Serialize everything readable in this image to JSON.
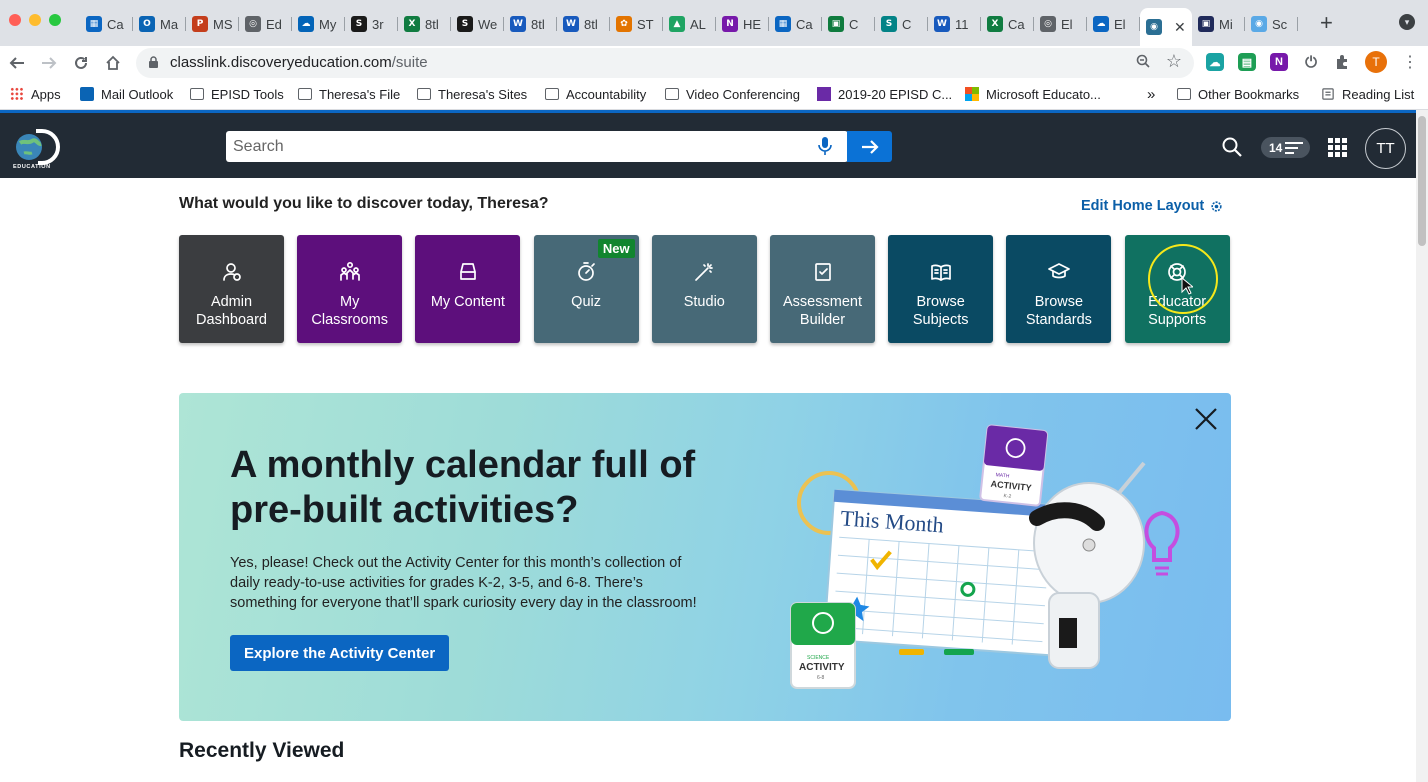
{
  "browser": {
    "tabs": [
      {
        "icon": "calendar-favicon",
        "label": "Ca",
        "color": "#0b66c2",
        "glyph": "▦"
      },
      {
        "icon": "outlook-favicon",
        "label": "Ma",
        "color": "#0a64b4",
        "glyph": "O"
      },
      {
        "icon": "powerpoint-favicon",
        "label": "MS",
        "color": "#c43e1c",
        "glyph": "P"
      },
      {
        "icon": "globe-favicon",
        "label": "Ed",
        "color": "#5f6368",
        "glyph": "◎"
      },
      {
        "icon": "onedrive-favicon",
        "label": "My",
        "color": "#0364b8",
        "glyph": "☁"
      },
      {
        "icon": "s-favicon",
        "label": "3r",
        "color": "#1a1a1a",
        "glyph": "S"
      },
      {
        "icon": "excel-favicon",
        "label": "8tl",
        "color": "#107c41",
        "glyph": "X"
      },
      {
        "icon": "s-favicon",
        "label": "We",
        "color": "#1a1a1a",
        "glyph": "S"
      },
      {
        "icon": "word-favicon",
        "label": "8tl",
        "color": "#185abd",
        "glyph": "W"
      },
      {
        "icon": "word-favicon",
        "label": "8tl",
        "color": "#185abd",
        "glyph": "W"
      },
      {
        "icon": "multicolor-favicon",
        "label": "ST",
        "color": "#e37400",
        "glyph": "✿"
      },
      {
        "icon": "drive-favicon",
        "label": "AL",
        "color": "#1fa463",
        "glyph": "▲"
      },
      {
        "icon": "onenote-favicon",
        "label": "HE",
        "color": "#7719aa",
        "glyph": "N"
      },
      {
        "icon": "calendar-favicon",
        "label": "Ca",
        "color": "#0b66c2",
        "glyph": "▦"
      },
      {
        "icon": "green-favicon",
        "label": "C",
        "color": "#0f7b3e",
        "glyph": "▣"
      },
      {
        "icon": "sharepoint-favicon",
        "label": "C",
        "color": "#038387",
        "glyph": "S"
      },
      {
        "icon": "word-favicon",
        "label": "11",
        "color": "#185abd",
        "glyph": "W"
      },
      {
        "icon": "excel-favicon",
        "label": "Ca",
        "color": "#107c41",
        "glyph": "X"
      },
      {
        "icon": "globe-favicon",
        "label": "El",
        "color": "#5f6368",
        "glyph": "◎"
      },
      {
        "icon": "cloud-favicon",
        "label": "El",
        "color": "#0b66c2",
        "glyph": "☁"
      },
      {
        "icon": "discovery-favicon",
        "label": "",
        "color": "#2b6f94",
        "glyph": "◉",
        "active": true
      },
      {
        "icon": "dark-favicon",
        "label": "Mi",
        "color": "#202a5a",
        "glyph": "▣"
      },
      {
        "icon": "circle-favicon",
        "label": "Sc",
        "color": "#5aa9e6",
        "glyph": "◉"
      }
    ],
    "url_host": "classlink.discoveryeducation.com",
    "url_path": "/suite",
    "bookmarks": [
      {
        "label": "Apps",
        "type": "apps"
      },
      {
        "label": "Mail Outlook",
        "type": "outlook"
      },
      {
        "label": "EPISD Tools",
        "type": "folder"
      },
      {
        "label": "Theresa's File",
        "type": "folder"
      },
      {
        "label": "Theresa's Sites",
        "type": "folder"
      },
      {
        "label": "Accountability",
        "type": "folder"
      },
      {
        "label": "Video Conferencing",
        "type": "folder"
      },
      {
        "label": "2019-20 EPISD C...",
        "type": "page"
      },
      {
        "label": "Microsoft Educato...",
        "type": "ms"
      }
    ],
    "bookmarks_overflow": "»",
    "other_bookmarks": "Other Bookmarks",
    "reading_list": "Reading List",
    "profile_initial": "T"
  },
  "header": {
    "search_placeholder": "Search",
    "notification_count": "14",
    "user_initials": "TT"
  },
  "greeting": "What would you like to discover today, Theresa?",
  "edit_layout": "Edit Home Layout",
  "tiles": [
    {
      "label": "Admin Dashboard",
      "lines": [
        "Admin",
        "Dashboard"
      ],
      "color": "#3b3d40",
      "icon": "admin-icon"
    },
    {
      "label": "My Classrooms",
      "lines": [
        "My",
        "Classrooms"
      ],
      "color": "#5d0f7c",
      "icon": "classrooms-icon"
    },
    {
      "label": "My Content",
      "lines": [
        "My Content"
      ],
      "color": "#5d0f7c",
      "icon": "content-icon"
    },
    {
      "label": "Quiz",
      "lines": [
        "Quiz"
      ],
      "color": "#476977",
      "icon": "quiz-icon",
      "badge": "New"
    },
    {
      "label": "Studio",
      "lines": [
        "Studio"
      ],
      "color": "#476977",
      "icon": "studio-icon"
    },
    {
      "label": "Assessment Builder",
      "lines": [
        "Assessment",
        "Builder"
      ],
      "color": "#476977",
      "icon": "assessment-icon"
    },
    {
      "label": "Browse Subjects",
      "lines": [
        "Browse",
        "Subjects"
      ],
      "color": "#0a4a63",
      "icon": "book-icon"
    },
    {
      "label": "Browse Standards",
      "lines": [
        "Browse",
        "Standards"
      ],
      "color": "#0a4a63",
      "icon": "mortarboard-icon"
    },
    {
      "label": "Educator Supports",
      "lines": [
        "Educator",
        "Supports"
      ],
      "color": "#107161",
      "icon": "lifebuoy-icon"
    }
  ],
  "banner": {
    "title": "A monthly calendar full of pre-built activities?",
    "body": "Yes, please! Check out the Activity Center for this month’s collection of daily ready-to-use activities for grades K-2, 3-5, and 6-8. There’s something for everyone that’ll spark curiosity every day in the classroom!",
    "cta": "Explore the Activity Center",
    "calendar_label": "This Month",
    "math_card_top": "MATH",
    "math_card": "ACTIVITY",
    "math_card_grades": "K-2",
    "science_card_top": "SCIENCE",
    "science_card": "ACTIVITY",
    "science_card_grades": "6-8"
  },
  "recently_viewed": "Recently Viewed",
  "colors": {
    "appbar": "#222b35",
    "accent_blue": "#0b66c2",
    "link": "#0b5fa8"
  }
}
